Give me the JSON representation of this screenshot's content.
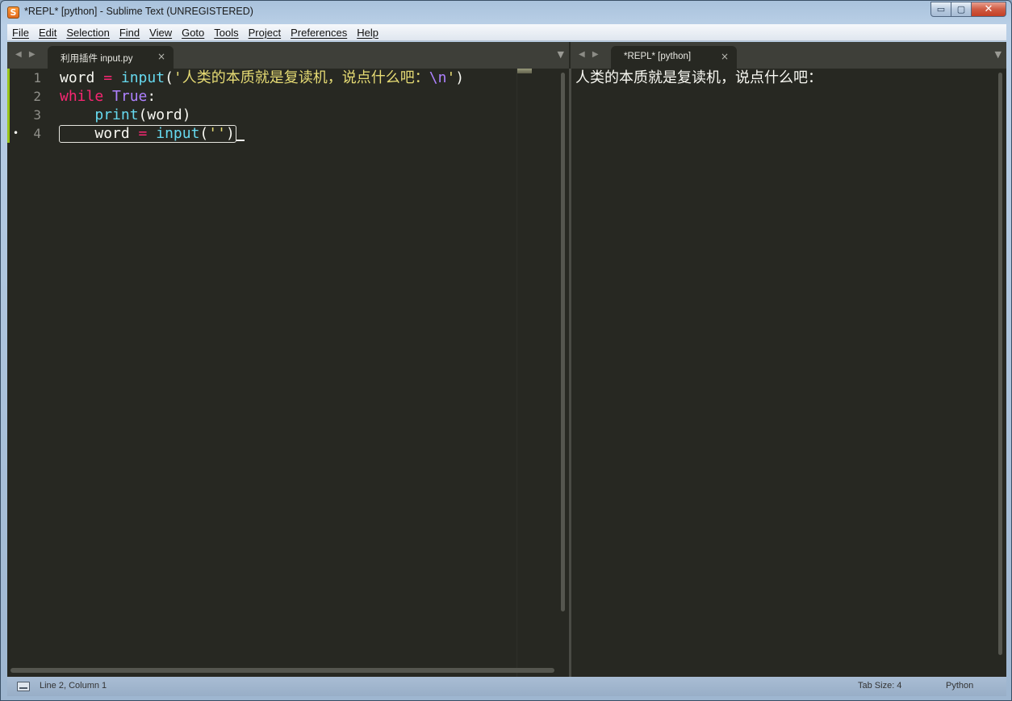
{
  "window": {
    "title": "*REPL* [python] - Sublime Text (UNREGISTERED)",
    "app_icon": "S",
    "controls": {
      "minimize": "▭",
      "maximize": "▢",
      "close": "✕"
    }
  },
  "menu": [
    "File",
    "Edit",
    "Selection",
    "Find",
    "View",
    "Goto",
    "Tools",
    "Project",
    "Preferences",
    "Help"
  ],
  "left_pane": {
    "nav_arrows": "◀ ▶",
    "tab_label": "利用插件 input.py",
    "tab_close": "×",
    "dropdown": "▼",
    "line_numbers": [
      "1",
      "2",
      "3",
      "4"
    ],
    "modified_dot": "•",
    "code": {
      "l1": {
        "var": "word",
        "op": " = ",
        "fn": "input",
        "open": "(",
        "str1": "'人类的本质就是复读机，说点什么吧：",
        "esc": "\\n",
        "str2": "'",
        "close": ")"
      },
      "l2": {
        "kw": "while",
        "space": " ",
        "const": "True",
        "colon": ":"
      },
      "l3": {
        "indent": "    ",
        "fn": "print",
        "rest": "(word)"
      },
      "l4": {
        "indent": "    ",
        "var": "word",
        "op": " = ",
        "fn": "input",
        "open": "(",
        "str": "''",
        "close": ")"
      }
    }
  },
  "right_pane": {
    "nav_arrows": "◀ ▶",
    "tab_label": "*REPL* [python]",
    "tab_close": "×",
    "dropdown": "▼",
    "output": "人类的本质就是复读机，说点什么吧："
  },
  "statusbar": {
    "position": "Line 2, Column 1",
    "tab_size": "Tab Size: 4",
    "syntax": "Python"
  },
  "colors": {
    "editor_bg": "#272822",
    "keyword": "#f92672",
    "function": "#66d9ef",
    "string": "#e6db74",
    "constant": "#ae81ff"
  }
}
